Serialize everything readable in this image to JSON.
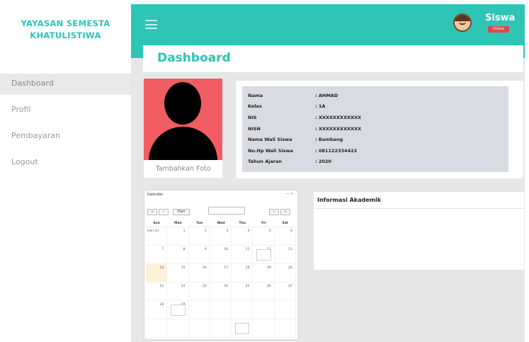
{
  "brand": {
    "line1": "YAYASAN SEMESTA",
    "line2": "KHATULISTIWA"
  },
  "nav": {
    "items": [
      {
        "label": "Dashboard"
      },
      {
        "label": "Profil"
      },
      {
        "label": "Pembayaran"
      },
      {
        "label": "Logout"
      }
    ]
  },
  "header": {
    "user_name": "Siswa",
    "badge": "Online"
  },
  "page": {
    "title": "Dashboard"
  },
  "photo": {
    "caption": "Tambahkan Foto"
  },
  "profile": {
    "rows": [
      {
        "key": "Nama",
        "value": ": AHMAD"
      },
      {
        "key": "Kelas",
        "value": ": 1A"
      },
      {
        "key": "NIS",
        "value": ": XXXXXXXXXXXX"
      },
      {
        "key": "NISN",
        "value": ": XXXXXXXXXXXX"
      },
      {
        "key": "Nama Wali Siswa",
        "value": ": Bambang"
      },
      {
        "key": "No.Hp Wali Siswa",
        "value": ": 081122334422"
      },
      {
        "key": "Tahun Ajaran",
        "value": ": 2020"
      }
    ]
  },
  "calendar": {
    "title": "Kalender",
    "window_controls": "— ×",
    "nav_prev": "◄ ◄",
    "today_btn": "Hari",
    "nav_next": "► ►",
    "days": [
      "Sun",
      "Mon",
      "Tue",
      "Wed",
      "Thu",
      "Fri",
      "Sat"
    ],
    "weeks": [
      [
        "",
        "1",
        "2",
        "3",
        "4",
        "5",
        "6"
      ],
      [
        "7",
        "8",
        "9",
        "10",
        "11",
        "12",
        "13"
      ],
      [
        "14",
        "15",
        "16",
        "17",
        "18",
        "19",
        "20"
      ],
      [
        "21",
        "22",
        "23",
        "24",
        "25",
        "26",
        "27"
      ],
      [
        "28",
        "29",
        "",
        "",
        "",
        "",
        ""
      ],
      [
        "",
        "",
        "",
        "",
        "",
        "",
        ""
      ]
    ],
    "today_label": "Hari ini"
  },
  "info": {
    "title": "Informasi Akademik"
  },
  "colors": {
    "accent": "#2ec4b6",
    "photo_bg": "#f25d63",
    "badge": "#e04848"
  }
}
